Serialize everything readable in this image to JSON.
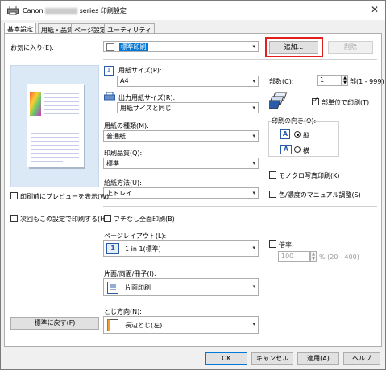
{
  "window": {
    "title_prefix": "Canon",
    "title_suffix": "series 印刷設定",
    "close_glyph": "✕"
  },
  "tabs": [
    {
      "label": "基本設定"
    },
    {
      "label": "用紙・品質"
    },
    {
      "label": "ページ設定"
    },
    {
      "label": "ユーティリティ"
    }
  ],
  "favorites": {
    "label": "お気に入り(E):",
    "value": "標準印刷",
    "add_button": "追加...",
    "delete_button": "削除"
  },
  "paper_size": {
    "label": "用紙サイズ(P):",
    "value": "A4"
  },
  "output_size": {
    "label": "出力用紙サイズ(R):",
    "value": "用紙サイズと同じ"
  },
  "media_type": {
    "label": "用紙の種類(M):",
    "value": "普通紙"
  },
  "print_quality": {
    "label": "印刷品質(Q):",
    "value": "標準"
  },
  "paper_source": {
    "label": "給紙方法(U):",
    "value": "上トレイ"
  },
  "copies": {
    "label": "部数(C):",
    "value": "1",
    "range": "部(1 - 999)"
  },
  "collate": {
    "label": "部単位で印刷(T)",
    "checked": true
  },
  "orientation": {
    "label": "印刷の向き(O):",
    "portrait": "縦",
    "landscape": "横",
    "icon_letter": "A",
    "selected": "portrait"
  },
  "grayscale": {
    "label": "モノクロ写真印刷(K)",
    "checked": false
  },
  "color_manual": {
    "label": "色/濃度のマニュアル調整(S)",
    "checked": false
  },
  "preview_before": {
    "label": "印刷前にプレビューを表示(W)",
    "checked": false
  },
  "print_next_time": {
    "label": "次回もこの設定で印刷する(H)",
    "checked": false
  },
  "borderless": {
    "label": "フチなし全面印刷(B)",
    "checked": false
  },
  "page_layout": {
    "label": "ページレイアウト(L):",
    "value": "1 in 1(標準)",
    "icon_num": "1"
  },
  "scaling": {
    "label": "倍率:",
    "checked": false,
    "value": "100",
    "range": "% (20 - 400)"
  },
  "duplex": {
    "label": "片面/両面/冊子(I):",
    "value": "片面印刷"
  },
  "binding": {
    "label": "とじ方向(N):",
    "value": "長辺とじ(左)"
  },
  "defaults_button": "標準に戻す(F)",
  "footer": {
    "ok": "OK",
    "cancel": "キャンセル",
    "apply": "適用(A)",
    "help": "ヘルプ"
  },
  "colors": {
    "highlight_border": "#e0201c",
    "preview_bg": "#dbe9f7"
  }
}
